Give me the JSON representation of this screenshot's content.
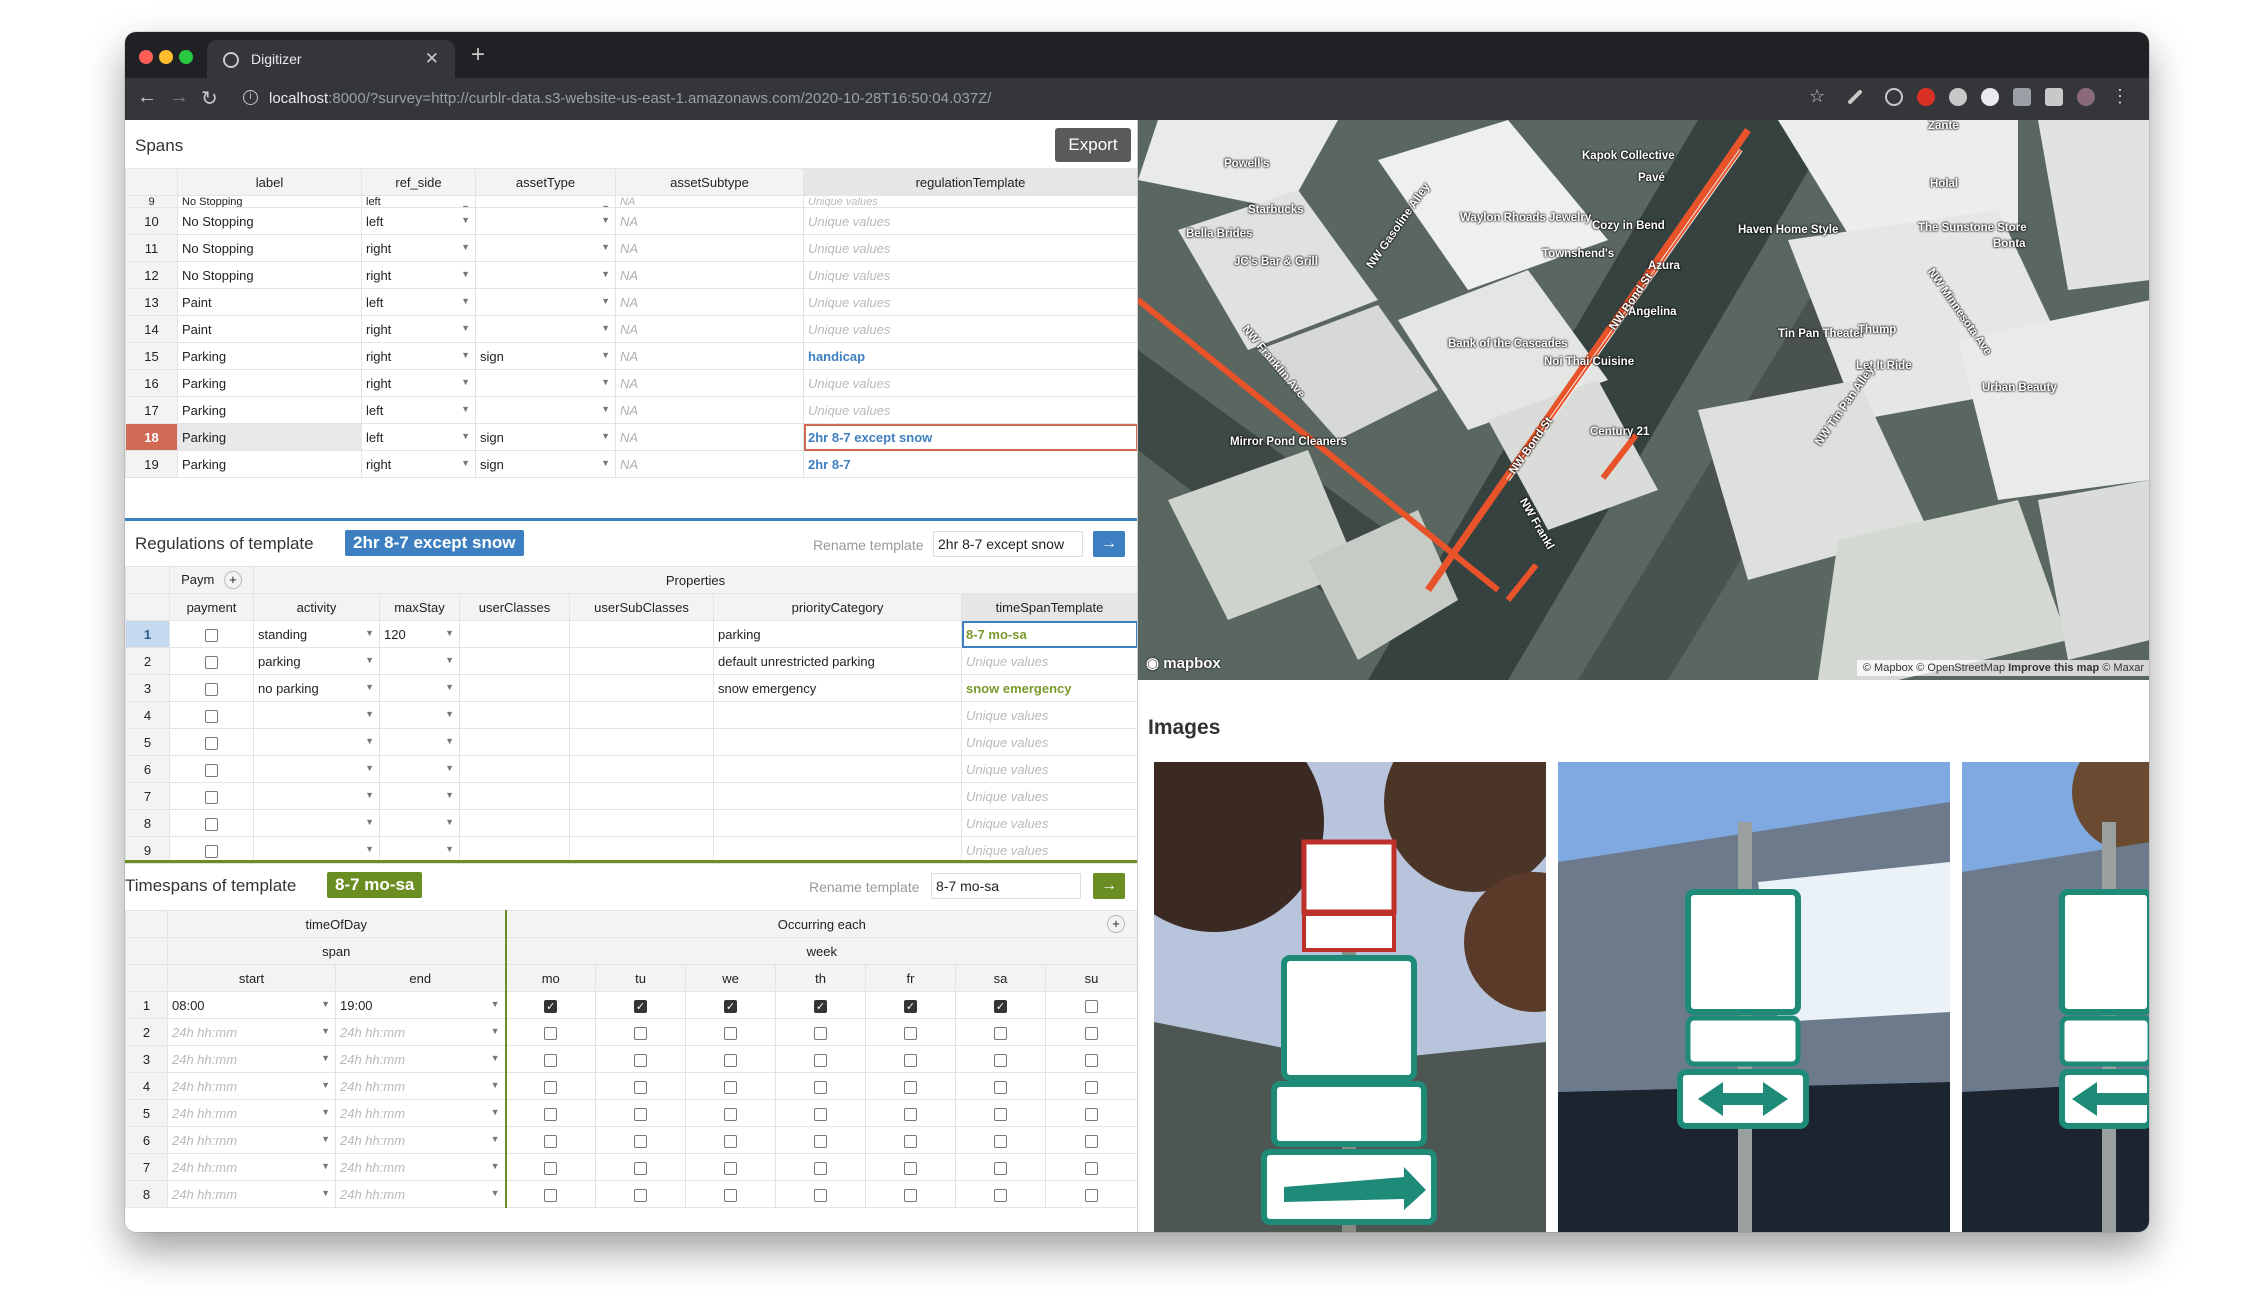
{
  "browser": {
    "tab_title": "Digitizer",
    "url_host": "localhost",
    "url_rest": ":8000/?survey=http://curblr-data.s3-website-us-east-1.amazonaws.com/2020-10-28T16:50:04.037Z/"
  },
  "spans": {
    "title": "Spans",
    "export_label": "Export",
    "columns": [
      "label",
      "ref_side",
      "assetType",
      "assetSubtype",
      "regulationTemplate"
    ],
    "rows": [
      {
        "n": "9",
        "label": "No Stopping",
        "side": "left",
        "asset": "",
        "sub": "NA",
        "reg": "Unique values",
        "regStyle": "uv"
      },
      {
        "n": "10",
        "label": "No Stopping",
        "side": "left",
        "asset": "",
        "sub": "NA",
        "reg": "Unique values",
        "regStyle": "uv"
      },
      {
        "n": "11",
        "label": "No Stopping",
        "side": "right",
        "asset": "",
        "sub": "NA",
        "reg": "Unique values",
        "regStyle": "uv"
      },
      {
        "n": "12",
        "label": "No Stopping",
        "side": "right",
        "asset": "",
        "sub": "NA",
        "reg": "Unique values",
        "regStyle": "uv"
      },
      {
        "n": "13",
        "label": "Paint",
        "side": "left",
        "asset": "",
        "sub": "NA",
        "reg": "Unique values",
        "regStyle": "uv"
      },
      {
        "n": "14",
        "label": "Paint",
        "side": "right",
        "asset": "",
        "sub": "NA",
        "reg": "Unique values",
        "regStyle": "uv"
      },
      {
        "n": "15",
        "label": "Parking",
        "side": "right",
        "asset": "sign",
        "sub": "NA",
        "reg": "handicap",
        "regStyle": "blue"
      },
      {
        "n": "16",
        "label": "Parking",
        "side": "right",
        "asset": "",
        "sub": "NA",
        "reg": "Unique values",
        "regStyle": "uv"
      },
      {
        "n": "17",
        "label": "Parking",
        "side": "left",
        "asset": "",
        "sub": "NA",
        "reg": "Unique values",
        "regStyle": "uv"
      },
      {
        "n": "18",
        "label": "Parking",
        "side": "left",
        "asset": "sign",
        "sub": "NA",
        "reg": "2hr 8-7 except snow",
        "regStyle": "blue",
        "selected": true
      },
      {
        "n": "19",
        "label": "Parking",
        "side": "right",
        "asset": "sign",
        "sub": "NA",
        "reg": "2hr 8-7",
        "regStyle": "blue"
      }
    ]
  },
  "regulations": {
    "title": "Regulations of template",
    "template": "2hr 8-7 except snow",
    "rename_label": "Rename template",
    "rename_value": "2hr 8-7 except snow",
    "group_payment": "Paym",
    "group_properties": "Properties",
    "columns": [
      "payment",
      "activity",
      "maxStay",
      "userClasses",
      "userSubClasses",
      "priorityCategory",
      "timeSpanTemplate"
    ],
    "rows": [
      {
        "n": "1",
        "activity": "standing",
        "maxStay": "120",
        "priority": "parking",
        "ts": "8-7 mo-sa",
        "tsStyle": "green"
      },
      {
        "n": "2",
        "activity": "parking",
        "maxStay": "",
        "priority": "default unrestricted parking",
        "ts": "Unique values",
        "tsStyle": "uv"
      },
      {
        "n": "3",
        "activity": "no parking",
        "maxStay": "",
        "priority": "snow emergency",
        "ts": "snow emergency",
        "tsStyle": "green"
      },
      {
        "n": "4",
        "activity": "",
        "maxStay": "",
        "priority": "",
        "ts": "Unique values",
        "tsStyle": "uv"
      },
      {
        "n": "5",
        "activity": "",
        "maxStay": "",
        "priority": "",
        "ts": "Unique values",
        "tsStyle": "uv"
      },
      {
        "n": "6",
        "activity": "",
        "maxStay": "",
        "priority": "",
        "ts": "Unique values",
        "tsStyle": "uv"
      },
      {
        "n": "7",
        "activity": "",
        "maxStay": "",
        "priority": "",
        "ts": "Unique values",
        "tsStyle": "uv"
      },
      {
        "n": "8",
        "activity": "",
        "maxStay": "",
        "priority": "",
        "ts": "Unique values",
        "tsStyle": "uv"
      },
      {
        "n": "9",
        "activity": "",
        "maxStay": "",
        "priority": "",
        "ts": "Unique values",
        "tsStyle": "uv"
      }
    ]
  },
  "timespans": {
    "title": "Timespans of template",
    "template": "8-7 mo-sa",
    "rename_label": "Rename template",
    "rename_value": "8-7 mo-sa",
    "group_timeofday": "timeOfDay",
    "group_occurring": "Occurring each",
    "sub_span": "span",
    "sub_week": "week",
    "columns": [
      "start",
      "end",
      "mo",
      "tu",
      "we",
      "th",
      "fr",
      "sa",
      "su"
    ],
    "placeholder": "24h hh:mm",
    "rows": [
      {
        "n": "1",
        "start": "08:00",
        "end": "19:00",
        "days": [
          1,
          1,
          1,
          1,
          1,
          1,
          0
        ]
      },
      {
        "n": "2",
        "start": "",
        "end": "",
        "days": [
          0,
          0,
          0,
          0,
          0,
          0,
          0
        ]
      },
      {
        "n": "3",
        "start": "",
        "end": "",
        "days": [
          0,
          0,
          0,
          0,
          0,
          0,
          0
        ]
      },
      {
        "n": "4",
        "start": "",
        "end": "",
        "days": [
          0,
          0,
          0,
          0,
          0,
          0,
          0
        ]
      },
      {
        "n": "5",
        "start": "",
        "end": "",
        "days": [
          0,
          0,
          0,
          0,
          0,
          0,
          0
        ]
      },
      {
        "n": "6",
        "start": "",
        "end": "",
        "days": [
          0,
          0,
          0,
          0,
          0,
          0,
          0
        ]
      },
      {
        "n": "7",
        "start": "",
        "end": "",
        "days": [
          0,
          0,
          0,
          0,
          0,
          0,
          0
        ]
      },
      {
        "n": "8",
        "start": "",
        "end": "",
        "days": [
          0,
          0,
          0,
          0,
          0,
          0,
          0
        ]
      }
    ]
  },
  "map": {
    "labels": [
      "Zante",
      "Powell's",
      "Kapok Collective",
      "Pavé",
      "Holal",
      "Starbucks",
      "Waylon Rhoads Jewelry",
      "Cozy in Bend",
      "The Sunstone Store",
      "Haven Home Style",
      "Bella Brides",
      "Bonta",
      "Townshend's",
      "JC's Bar & Grill",
      "Azura",
      "NW Bond St",
      "Angelina",
      "NW Minnesota Ave",
      "NW Franklin Ave",
      "Tin Pan Theater",
      "Thump",
      "Bank of the Cascades",
      "Let It Ride",
      "Noi Thai Cuisine",
      "Urban Beauty",
      "NW Gasoline Alley",
      "NW Tin Pan Alley",
      "Mirror Pond Cleaners",
      "Century 21",
      "NW Bond St",
      "NW Frankl"
    ],
    "brand": "mapbox",
    "attribution": "© Mapbox © OpenStreetMap",
    "improve": "Improve this map",
    "maxar": "© Maxar"
  },
  "images": {
    "title": "Images"
  },
  "colors": {
    "accent_red": "#e8532a",
    "blue": "#3d7fc0",
    "green": "#6b8e23"
  }
}
